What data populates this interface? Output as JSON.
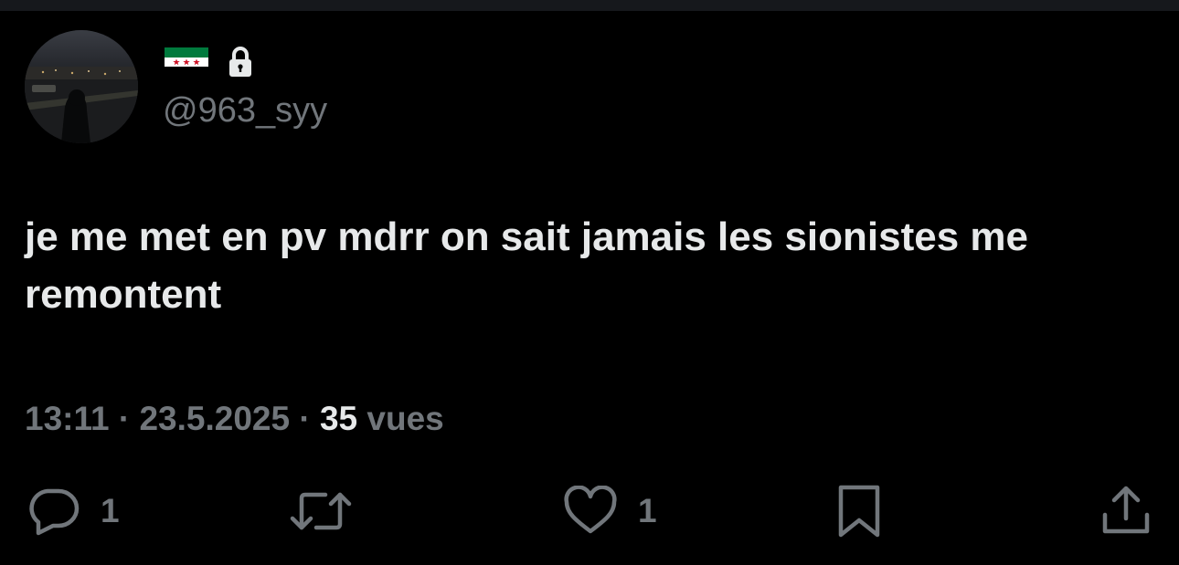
{
  "header": {
    "handle": "@963_syy",
    "icons": {
      "flag": "syria-independence-flag-icon",
      "lock": "lock-icon"
    }
  },
  "tweet": {
    "text": "je me met en pv mdrr on sait jamais les sionistes me remontent"
  },
  "meta": {
    "time": "13:11",
    "separator": "·",
    "date": "23.5.2025",
    "views_count": "35",
    "views_label": "vues"
  },
  "actions": {
    "reply_count": "1",
    "like_count": "1",
    "icons": [
      "reply-icon",
      "repost-icon",
      "like-icon",
      "bookmark-icon",
      "share-icon"
    ]
  },
  "colors": {
    "background": "#000000",
    "text_primary": "#e7e9ea",
    "text_secondary": "#71767b",
    "flag_green": "#007a3d",
    "flag_white": "#ffffff",
    "flag_black": "#000000",
    "flag_star_red": "#ce1126"
  }
}
